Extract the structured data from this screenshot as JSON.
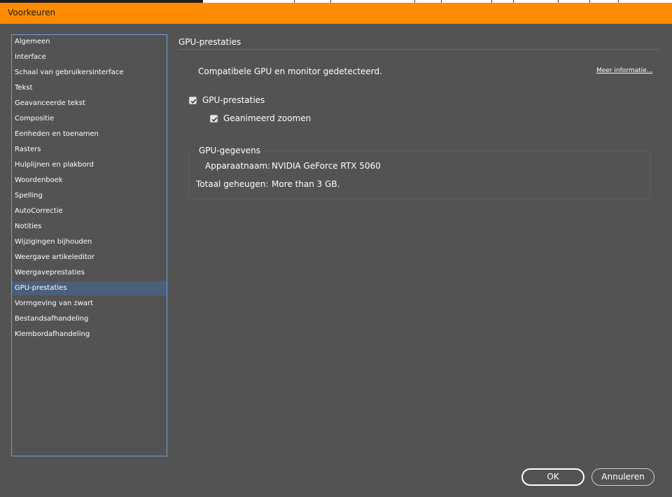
{
  "window": {
    "title": "Voorkeuren"
  },
  "sidebar": {
    "items": [
      {
        "label": "Algemeen"
      },
      {
        "label": "Interface"
      },
      {
        "label": "Schaal van gebruikersinterface"
      },
      {
        "label": "Tekst"
      },
      {
        "label": "Geavanceerde tekst"
      },
      {
        "label": "Compositie"
      },
      {
        "label": "Eenheden en toenamen"
      },
      {
        "label": "Rasters"
      },
      {
        "label": "Hulplijnen en plakbord"
      },
      {
        "label": "Woordenboek"
      },
      {
        "label": "Spelling"
      },
      {
        "label": "AutoCorrectie"
      },
      {
        "label": "Notities"
      },
      {
        "label": "Wijzigingen bijhouden"
      },
      {
        "label": "Weergave artikeleditor"
      },
      {
        "label": "Weergaveprestaties"
      },
      {
        "label": "GPU-prestaties"
      },
      {
        "label": "Vormgeving van zwart"
      },
      {
        "label": "Bestandsafhandeling"
      },
      {
        "label": "Klembordafhandeling"
      }
    ],
    "selected_index": 16
  },
  "panel": {
    "title": "GPU-prestaties",
    "status_text": "Compatibele GPU en monitor gedetecteerd.",
    "more_info_link": "Meer informatie...",
    "gpu_performance": {
      "label": "GPU-prestaties",
      "checked": true
    },
    "animated_zoom": {
      "label": "Geanimeerd zoomen",
      "checked": true
    }
  },
  "gpu_info": {
    "legend": "GPU-gegevens",
    "device_name_label": "Apparaatnaam:",
    "device_name_value": "NVIDIA GeForce RTX 5060",
    "total_memory_label": "Totaal geheugen:",
    "total_memory_value": "More than 3 GB."
  },
  "buttons": {
    "ok": "OK",
    "cancel": "Annuleren"
  },
  "colors": {
    "titlebar": "#ff8c00",
    "background": "#535353",
    "sidebar_border": "#6fa0d8",
    "selection": "#4a5f7a"
  }
}
